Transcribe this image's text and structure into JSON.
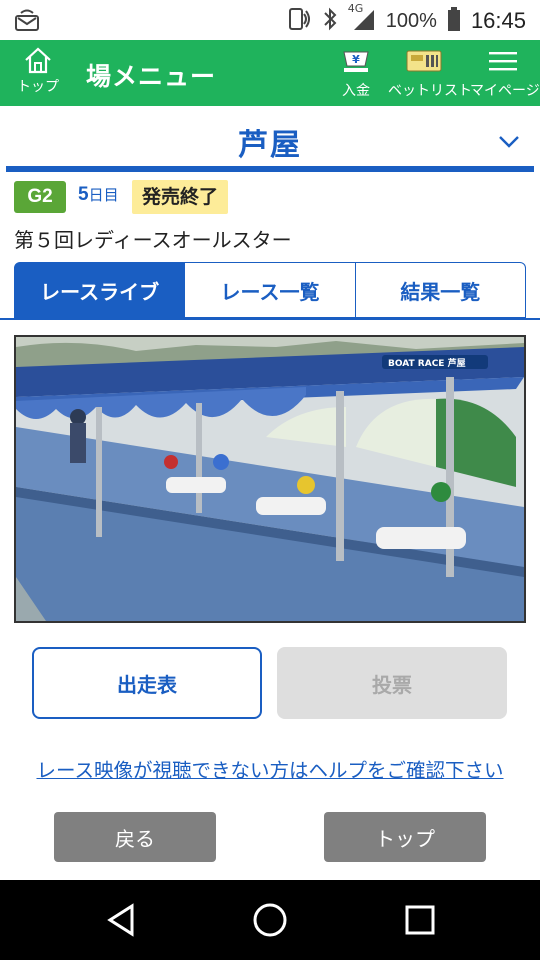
{
  "status_bar": {
    "network": "4G",
    "battery": "100%",
    "time": "16:45"
  },
  "header": {
    "home_label": "トップ",
    "title": "場メニュー",
    "nav": [
      {
        "label": "入金",
        "icon": "deposit-icon"
      },
      {
        "label": "ベットリスト",
        "icon": "betlist-icon"
      },
      {
        "label": "マイページ",
        "icon": "menu-icon"
      }
    ]
  },
  "venue": {
    "name": "芦屋"
  },
  "race": {
    "grade": "G2",
    "day_number": "5",
    "day_suffix": "日目",
    "sale_status": "発売終了",
    "title": "第５回レディースオールスター"
  },
  "tabs": [
    {
      "label": "レースライブ",
      "active": true
    },
    {
      "label": "レース一覧",
      "active": false
    },
    {
      "label": "結果一覧",
      "active": false
    }
  ],
  "video": {
    "logo_text": "BOAT RACE 芦屋"
  },
  "actions": {
    "entry_label": "出走表",
    "vote_label": "投票"
  },
  "help_link": "レース映像が視聴できない方はヘルプをご確認下さい",
  "footer": {
    "back_label": "戻る",
    "top_label": "トップ"
  },
  "colors": {
    "header_green": "#1fb35c",
    "accent_blue": "#1a5ec2",
    "grade_green": "#5aa637",
    "sale_yellow": "#fdec99"
  }
}
